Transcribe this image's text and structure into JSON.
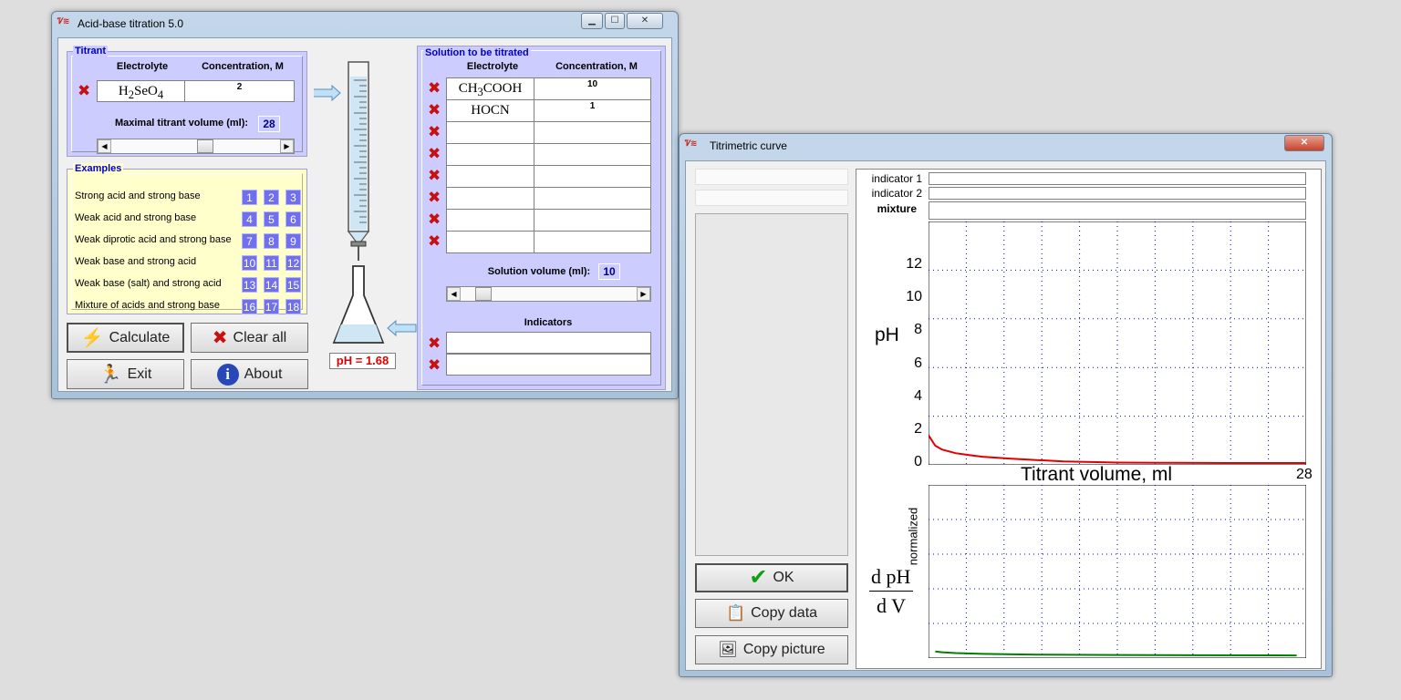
{
  "main_window": {
    "title": "Acid-base titration 5.0",
    "titrant": {
      "legend": "Titrant",
      "col_electrolyte": "Electrolyte",
      "col_concentration": "Concentration, M",
      "electrolyte_html": "H<sub>2</sub>SeO<sub>4</sub>",
      "concentration": "2",
      "max_volume_label": "Maximal titrant volume (ml):",
      "max_volume": "28",
      "slider_fraction": 0.56
    },
    "examples": {
      "legend": "Examples",
      "rows": [
        {
          "label": "Strong acid and strong base",
          "nums": [
            "1",
            "2",
            "3"
          ]
        },
        {
          "label": "Weak acid and strong base",
          "nums": [
            "4",
            "5",
            "6"
          ]
        },
        {
          "label": "Weak diprotic acid and strong base",
          "nums": [
            "7",
            "8",
            "9"
          ]
        },
        {
          "label": "Weak base and strong acid",
          "nums": [
            "10",
            "11",
            "12"
          ]
        },
        {
          "label": "Weak base (salt) and strong acid",
          "nums": [
            "13",
            "14",
            "15"
          ]
        },
        {
          "label": "Mixture of acids and strong base",
          "nums": [
            "16",
            "17",
            "18"
          ]
        }
      ]
    },
    "buttons": {
      "calculate": "Calculate",
      "clear_all": "Clear all",
      "exit": "Exit",
      "about": "About"
    },
    "ph_display": "pH = 1.68",
    "solution": {
      "legend": "Solution to be titrated",
      "col_electrolyte": "Electrolyte",
      "col_concentration": "Concentration, M",
      "rows": [
        {
          "electrolyte_html": "CH<sub>3</sub>COOH",
          "concentration": "10"
        },
        {
          "electrolyte_html": "HOCN",
          "concentration": "1"
        },
        {
          "electrolyte_html": "",
          "concentration": ""
        },
        {
          "electrolyte_html": "",
          "concentration": ""
        },
        {
          "electrolyte_html": "",
          "concentration": ""
        },
        {
          "electrolyte_html": "",
          "concentration": ""
        },
        {
          "electrolyte_html": "",
          "concentration": ""
        },
        {
          "electrolyte_html": "",
          "concentration": ""
        }
      ],
      "volume_label": "Solution volume (ml):",
      "volume": "10",
      "slider_fraction": 0.09,
      "indicators_label": "Indicators"
    }
  },
  "curve_window": {
    "title": "Titrimetric curve",
    "indicator1_label": "indicator 1",
    "indicator2_label": "indicator 2",
    "mixture_label": "mixture",
    "ok_button": "OK",
    "copy_data_button": "Copy data",
    "copy_picture_button": "Copy picture",
    "ph_axis_label": "pH",
    "x_axis_label": "Titrant volume, ml",
    "x_max_label": "28",
    "normalized_label": "normalized",
    "deriv_label_top": "d pH",
    "deriv_label_bottom": "d V",
    "colors": {
      "ph_curve": "#e00000",
      "deriv_curve": "#008000",
      "grid": "#0000c0"
    }
  },
  "chart_data": [
    {
      "type": "line",
      "title": "",
      "xlabel": "Titrant volume, ml",
      "ylabel": "pH",
      "xlim": [
        0,
        28
      ],
      "ylim": [
        0,
        14
      ],
      "yticks": [
        0,
        2,
        4,
        6,
        8,
        10,
        12
      ],
      "grid": true,
      "series": [
        {
          "x": [
            0,
            0.5,
            1,
            2,
            3,
            4,
            6,
            8,
            10,
            14,
            18,
            22,
            28
          ],
          "values": [
            1.68,
            1.05,
            0.82,
            0.6,
            0.48,
            0.38,
            0.27,
            0.18,
            0.1,
            0.03,
            0.01,
            0.0,
            0.0
          ]
        }
      ]
    },
    {
      "type": "line",
      "title": "",
      "xlabel": "",
      "ylabel": "normalized",
      "xlim": [
        0,
        28
      ],
      "ylim": [
        0,
        1
      ],
      "grid": true,
      "series": [
        {
          "x": [
            0.5,
            1,
            2,
            4,
            8,
            14,
            20,
            27.3
          ],
          "values": [
            0.03,
            0.025,
            0.02,
            0.015,
            0.01,
            0.008,
            0.006,
            0.005
          ]
        }
      ]
    }
  ]
}
